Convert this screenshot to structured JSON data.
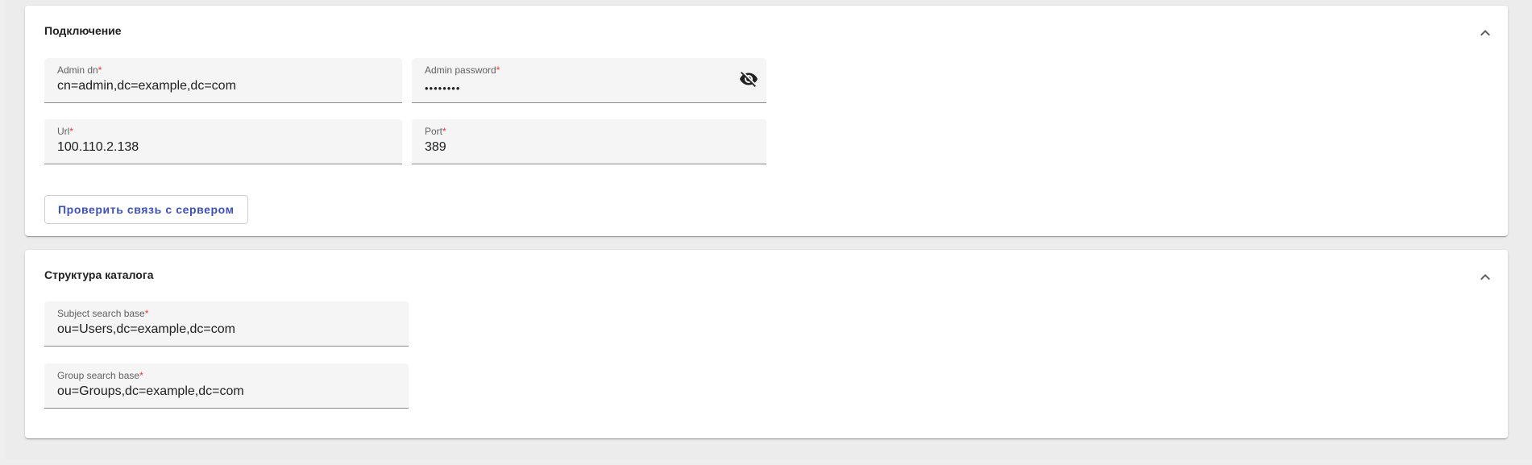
{
  "connection": {
    "title": "Подключение",
    "admin_dn": {
      "label": "Admin dn",
      "required_mark": "*",
      "value": "cn=admin,dc=example,dc=com"
    },
    "admin_password": {
      "label": "Admin password",
      "required_mark": "*",
      "value": "••••••••"
    },
    "url": {
      "label": "Url",
      "required_mark": "*",
      "value": "100.110.2.138"
    },
    "port": {
      "label": "Port",
      "required_mark": "*",
      "value": "389"
    },
    "check_button_label": "Проверить связь с сервером"
  },
  "directory": {
    "title": "Структура каталога",
    "subject_search_base": {
      "label": "Subject search base",
      "required_mark": "*",
      "value": "ou=Users,dc=example,dc=com"
    },
    "group_search_base": {
      "label": "Group search base",
      "required_mark": "*",
      "value": "ou=Groups,dc=example,dc=com"
    }
  },
  "icons": {
    "collapse": "chevron-up-icon",
    "password_visibility": "eye-off-icon"
  },
  "colors": {
    "accent": "#3f51b5",
    "required": "#e53935",
    "field_bg": "#f5f5f5"
  }
}
